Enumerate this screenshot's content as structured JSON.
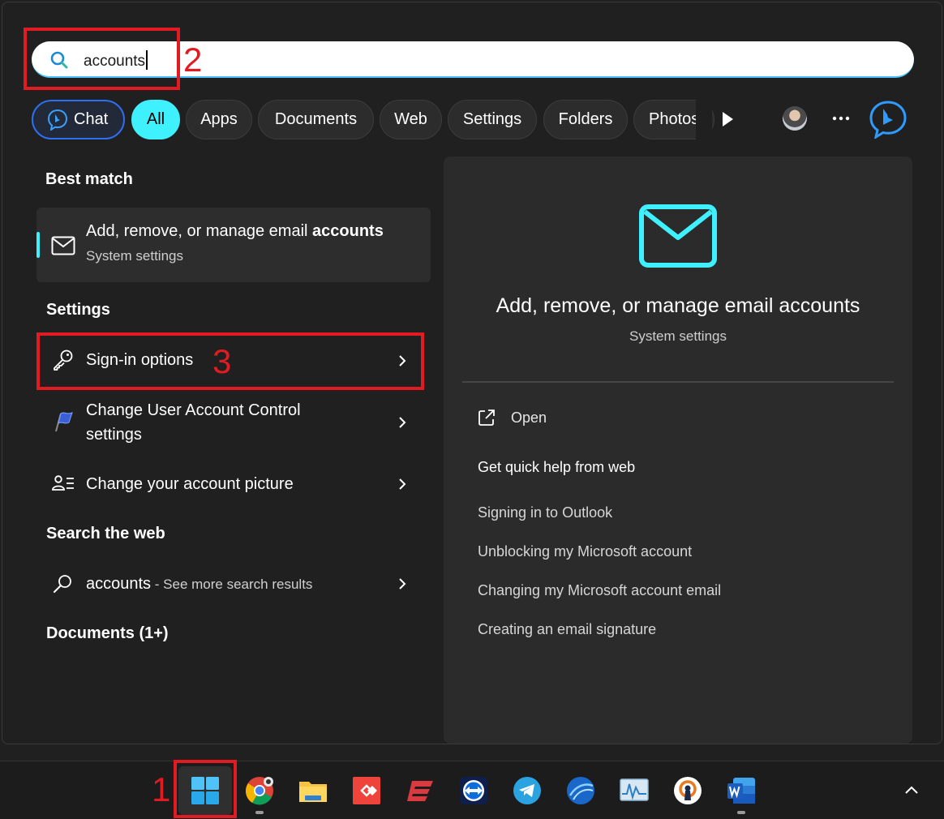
{
  "search": {
    "query": "accounts"
  },
  "filters": [
    {
      "label": "Chat"
    },
    {
      "label": "All"
    },
    {
      "label": "Apps"
    },
    {
      "label": "Documents"
    },
    {
      "label": "Web"
    },
    {
      "label": "Settings"
    },
    {
      "label": "Folders"
    },
    {
      "label": "Photos"
    }
  ],
  "sections": {
    "best_match": "Best match",
    "settings": "Settings",
    "search_web": "Search the web",
    "documents": "Documents (1+)"
  },
  "best_match_item": {
    "title_prefix": "Add, remove, or manage email ",
    "title_bold": "accounts",
    "subtitle": "System settings"
  },
  "settings_items": [
    {
      "label": "Sign-in options"
    },
    {
      "label_line1": "Change User Account Control",
      "label_line2": "settings"
    },
    {
      "label": "Change your account picture"
    }
  ],
  "web_item": {
    "query": "accounts",
    "suffix": " - See more search results"
  },
  "preview": {
    "title": "Add, remove, or manage email accounts",
    "subtitle": "System settings",
    "open_label": "Open",
    "help_title": "Get quick help from web",
    "links": [
      "Signing in to Outlook",
      "Unblocking my Microsoft account",
      "Changing my Microsoft account email",
      "Creating an email signature"
    ]
  },
  "annotations": [
    "1",
    "2",
    "3"
  ],
  "colors": {
    "accent": "#3ff0ff",
    "annotation": "#e21b23",
    "chat_border": "#2f6ff2"
  },
  "taskbar_icons": [
    "windows-start-icon",
    "chrome-icon",
    "file-explorer-icon",
    "anydesk-icon",
    "expressvpn-icon",
    "teamviewer-icon",
    "telegram-icon",
    "browser-sphere-icon",
    "monitor-app-icon",
    "openvpn-icon",
    "word-icon"
  ]
}
